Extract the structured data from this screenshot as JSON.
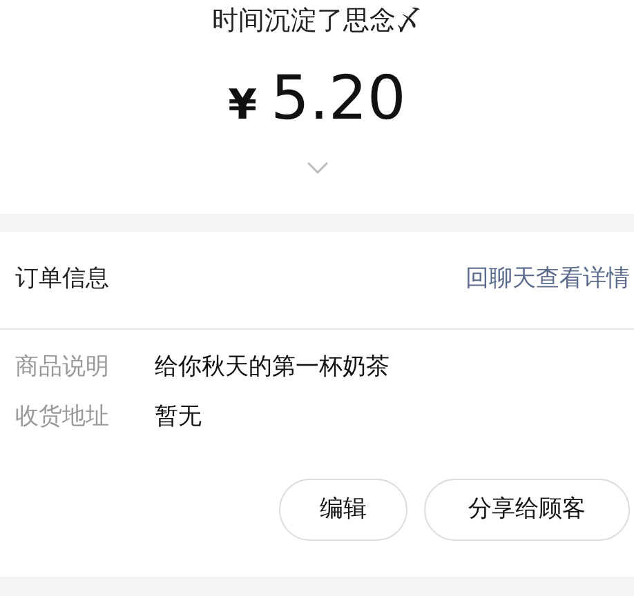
{
  "payment": {
    "note": "时间沉淀了思念〆",
    "currency": "¥",
    "amount": "5.20"
  },
  "order": {
    "title": "订单信息",
    "link": "回聊天查看详情",
    "fields": [
      {
        "label": "商品说明",
        "value": "给你秋天的第一杯奶茶"
      },
      {
        "label": "收货地址",
        "value": "暂无"
      }
    ],
    "buttons": [
      "编辑",
      "分享给顾客"
    ]
  }
}
